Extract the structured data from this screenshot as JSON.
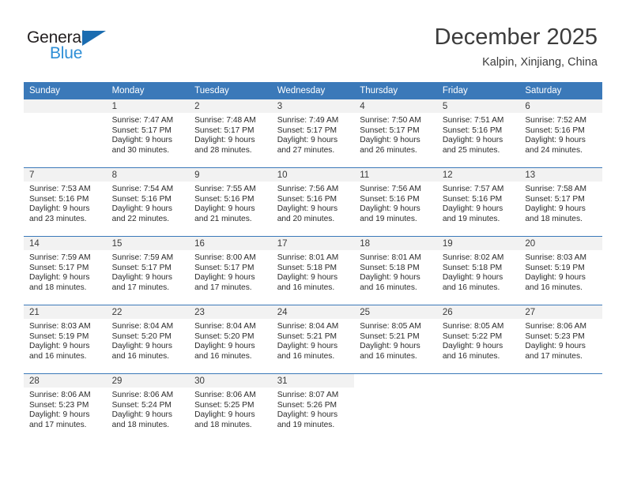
{
  "brand": {
    "name_top": "General",
    "name_bottom": "Blue",
    "triangle_color": "#1b6cb0",
    "blue_color": "#2d8ed6"
  },
  "header": {
    "title": "December 2025",
    "subtitle": "Kalpin, Xinjiang, China"
  },
  "theme": {
    "header_row_bg": "#3b79b9",
    "daynum_band_bg": "#f2f2f2",
    "grid_line": "#3b79b9"
  },
  "weekdays": [
    "Sunday",
    "Monday",
    "Tuesday",
    "Wednesday",
    "Thursday",
    "Friday",
    "Saturday"
  ],
  "weeks": [
    [
      {
        "day": "",
        "sunrise": "",
        "sunset": "",
        "daylight1": "",
        "daylight2": "",
        "empty": true
      },
      {
        "day": "1",
        "sunrise": "Sunrise: 7:47 AM",
        "sunset": "Sunset: 5:17 PM",
        "daylight1": "Daylight: 9 hours",
        "daylight2": "and 30 minutes."
      },
      {
        "day": "2",
        "sunrise": "Sunrise: 7:48 AM",
        "sunset": "Sunset: 5:17 PM",
        "daylight1": "Daylight: 9 hours",
        "daylight2": "and 28 minutes."
      },
      {
        "day": "3",
        "sunrise": "Sunrise: 7:49 AM",
        "sunset": "Sunset: 5:17 PM",
        "daylight1": "Daylight: 9 hours",
        "daylight2": "and 27 minutes."
      },
      {
        "day": "4",
        "sunrise": "Sunrise: 7:50 AM",
        "sunset": "Sunset: 5:17 PM",
        "daylight1": "Daylight: 9 hours",
        "daylight2": "and 26 minutes."
      },
      {
        "day": "5",
        "sunrise": "Sunrise: 7:51 AM",
        "sunset": "Sunset: 5:16 PM",
        "daylight1": "Daylight: 9 hours",
        "daylight2": "and 25 minutes."
      },
      {
        "day": "6",
        "sunrise": "Sunrise: 7:52 AM",
        "sunset": "Sunset: 5:16 PM",
        "daylight1": "Daylight: 9 hours",
        "daylight2": "and 24 minutes."
      }
    ],
    [
      {
        "day": "7",
        "sunrise": "Sunrise: 7:53 AM",
        "sunset": "Sunset: 5:16 PM",
        "daylight1": "Daylight: 9 hours",
        "daylight2": "and 23 minutes."
      },
      {
        "day": "8",
        "sunrise": "Sunrise: 7:54 AM",
        "sunset": "Sunset: 5:16 PM",
        "daylight1": "Daylight: 9 hours",
        "daylight2": "and 22 minutes."
      },
      {
        "day": "9",
        "sunrise": "Sunrise: 7:55 AM",
        "sunset": "Sunset: 5:16 PM",
        "daylight1": "Daylight: 9 hours",
        "daylight2": "and 21 minutes."
      },
      {
        "day": "10",
        "sunrise": "Sunrise: 7:56 AM",
        "sunset": "Sunset: 5:16 PM",
        "daylight1": "Daylight: 9 hours",
        "daylight2": "and 20 minutes."
      },
      {
        "day": "11",
        "sunrise": "Sunrise: 7:56 AM",
        "sunset": "Sunset: 5:16 PM",
        "daylight1": "Daylight: 9 hours",
        "daylight2": "and 19 minutes."
      },
      {
        "day": "12",
        "sunrise": "Sunrise: 7:57 AM",
        "sunset": "Sunset: 5:16 PM",
        "daylight1": "Daylight: 9 hours",
        "daylight2": "and 19 minutes."
      },
      {
        "day": "13",
        "sunrise": "Sunrise: 7:58 AM",
        "sunset": "Sunset: 5:17 PM",
        "daylight1": "Daylight: 9 hours",
        "daylight2": "and 18 minutes."
      }
    ],
    [
      {
        "day": "14",
        "sunrise": "Sunrise: 7:59 AM",
        "sunset": "Sunset: 5:17 PM",
        "daylight1": "Daylight: 9 hours",
        "daylight2": "and 18 minutes."
      },
      {
        "day": "15",
        "sunrise": "Sunrise: 7:59 AM",
        "sunset": "Sunset: 5:17 PM",
        "daylight1": "Daylight: 9 hours",
        "daylight2": "and 17 minutes."
      },
      {
        "day": "16",
        "sunrise": "Sunrise: 8:00 AM",
        "sunset": "Sunset: 5:17 PM",
        "daylight1": "Daylight: 9 hours",
        "daylight2": "and 17 minutes."
      },
      {
        "day": "17",
        "sunrise": "Sunrise: 8:01 AM",
        "sunset": "Sunset: 5:18 PM",
        "daylight1": "Daylight: 9 hours",
        "daylight2": "and 16 minutes."
      },
      {
        "day": "18",
        "sunrise": "Sunrise: 8:01 AM",
        "sunset": "Sunset: 5:18 PM",
        "daylight1": "Daylight: 9 hours",
        "daylight2": "and 16 minutes."
      },
      {
        "day": "19",
        "sunrise": "Sunrise: 8:02 AM",
        "sunset": "Sunset: 5:18 PM",
        "daylight1": "Daylight: 9 hours",
        "daylight2": "and 16 minutes."
      },
      {
        "day": "20",
        "sunrise": "Sunrise: 8:03 AM",
        "sunset": "Sunset: 5:19 PM",
        "daylight1": "Daylight: 9 hours",
        "daylight2": "and 16 minutes."
      }
    ],
    [
      {
        "day": "21",
        "sunrise": "Sunrise: 8:03 AM",
        "sunset": "Sunset: 5:19 PM",
        "daylight1": "Daylight: 9 hours",
        "daylight2": "and 16 minutes."
      },
      {
        "day": "22",
        "sunrise": "Sunrise: 8:04 AM",
        "sunset": "Sunset: 5:20 PM",
        "daylight1": "Daylight: 9 hours",
        "daylight2": "and 16 minutes."
      },
      {
        "day": "23",
        "sunrise": "Sunrise: 8:04 AM",
        "sunset": "Sunset: 5:20 PM",
        "daylight1": "Daylight: 9 hours",
        "daylight2": "and 16 minutes."
      },
      {
        "day": "24",
        "sunrise": "Sunrise: 8:04 AM",
        "sunset": "Sunset: 5:21 PM",
        "daylight1": "Daylight: 9 hours",
        "daylight2": "and 16 minutes."
      },
      {
        "day": "25",
        "sunrise": "Sunrise: 8:05 AM",
        "sunset": "Sunset: 5:21 PM",
        "daylight1": "Daylight: 9 hours",
        "daylight2": "and 16 minutes."
      },
      {
        "day": "26",
        "sunrise": "Sunrise: 8:05 AM",
        "sunset": "Sunset: 5:22 PM",
        "daylight1": "Daylight: 9 hours",
        "daylight2": "and 16 minutes."
      },
      {
        "day": "27",
        "sunrise": "Sunrise: 8:06 AM",
        "sunset": "Sunset: 5:23 PM",
        "daylight1": "Daylight: 9 hours",
        "daylight2": "and 17 minutes."
      }
    ],
    [
      {
        "day": "28",
        "sunrise": "Sunrise: 8:06 AM",
        "sunset": "Sunset: 5:23 PM",
        "daylight1": "Daylight: 9 hours",
        "daylight2": "and 17 minutes."
      },
      {
        "day": "29",
        "sunrise": "Sunrise: 8:06 AM",
        "sunset": "Sunset: 5:24 PM",
        "daylight1": "Daylight: 9 hours",
        "daylight2": "and 18 minutes."
      },
      {
        "day": "30",
        "sunrise": "Sunrise: 8:06 AM",
        "sunset": "Sunset: 5:25 PM",
        "daylight1": "Daylight: 9 hours",
        "daylight2": "and 18 minutes."
      },
      {
        "day": "31",
        "sunrise": "Sunrise: 8:07 AM",
        "sunset": "Sunset: 5:26 PM",
        "daylight1": "Daylight: 9 hours",
        "daylight2": "and 19 minutes."
      },
      {
        "day": "",
        "sunrise": "",
        "sunset": "",
        "daylight1": "",
        "daylight2": "",
        "empty": true,
        "blank": true
      },
      {
        "day": "",
        "sunrise": "",
        "sunset": "",
        "daylight1": "",
        "daylight2": "",
        "empty": true,
        "blank": true
      },
      {
        "day": "",
        "sunrise": "",
        "sunset": "",
        "daylight1": "",
        "daylight2": "",
        "empty": true,
        "blank": true
      }
    ]
  ]
}
